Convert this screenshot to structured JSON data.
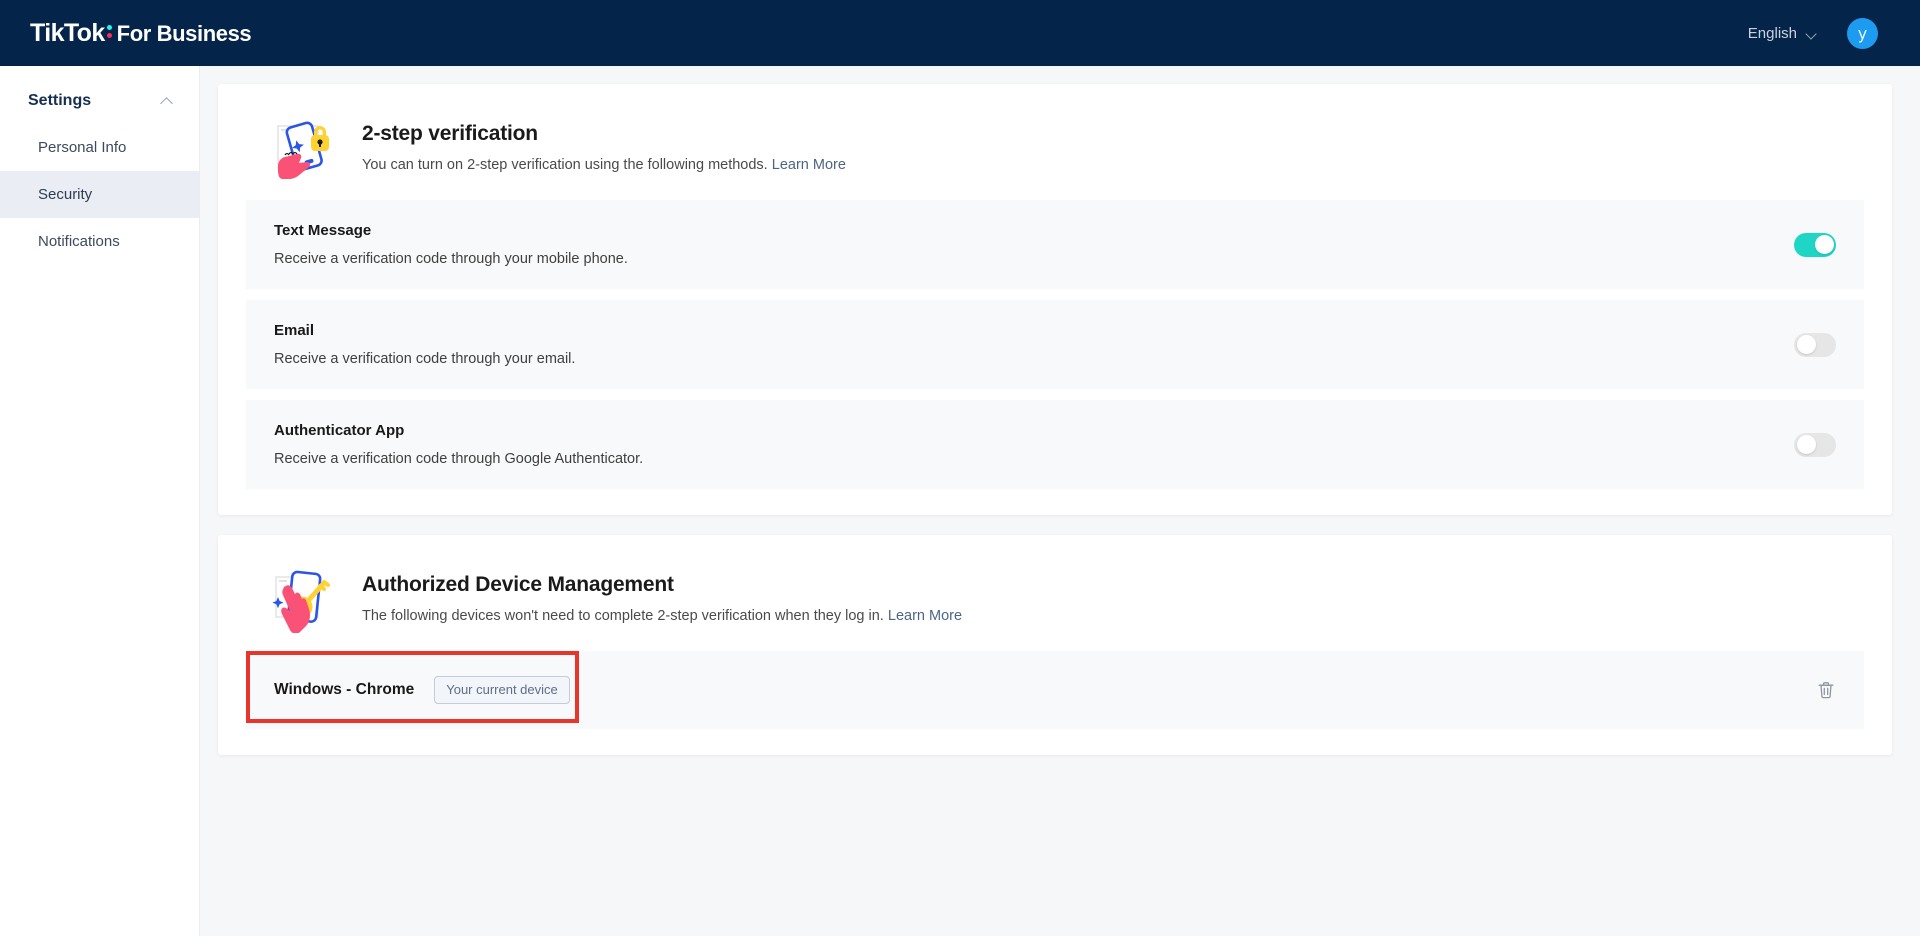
{
  "topbar": {
    "brand_primary": "TikTok",
    "brand_secondary": "For Business",
    "language": "English",
    "language_icon": "chevron-down-icon",
    "avatar_initial": "y"
  },
  "sidebar": {
    "group_label": "Settings",
    "collapse_icon": "chevron-up-icon",
    "items": [
      {
        "label": "Personal Info",
        "active": false
      },
      {
        "label": "Security",
        "active": true
      },
      {
        "label": "Notifications",
        "active": false
      }
    ]
  },
  "two_step": {
    "illustration": "phone-lock-illustration",
    "title": "2-step verification",
    "description": "You can turn on 2-step verification using the following methods.",
    "learn_more": "Learn More",
    "methods": [
      {
        "name": "Text Message",
        "description": "Receive a verification code through your mobile phone.",
        "enabled": true
      },
      {
        "name": "Email",
        "description": "Receive a verification code through your email.",
        "enabled": false
      },
      {
        "name": "Authenticator App",
        "description": "Receive a verification code through Google Authenticator.",
        "enabled": false
      }
    ]
  },
  "devices": {
    "illustration": "phone-key-illustration",
    "title": "Authorized Device Management",
    "description": "The following devices won't need to complete 2-step verification when they log in.",
    "learn_more": "Learn More",
    "list": [
      {
        "name": "Windows - Chrome",
        "badge": "Your current device",
        "delete_icon": "trash-icon",
        "highlighted": true
      }
    ]
  },
  "colors": {
    "header_bg": "#042449",
    "toggle_on": "#1fd6c6",
    "toggle_off": "#e6e6e6",
    "accent_link": "#4d6585",
    "annotation": "#e8342a",
    "avatar": "#1d9bf0",
    "brand_cyan": "#25f4ee",
    "brand_pink": "#fe2c55"
  }
}
